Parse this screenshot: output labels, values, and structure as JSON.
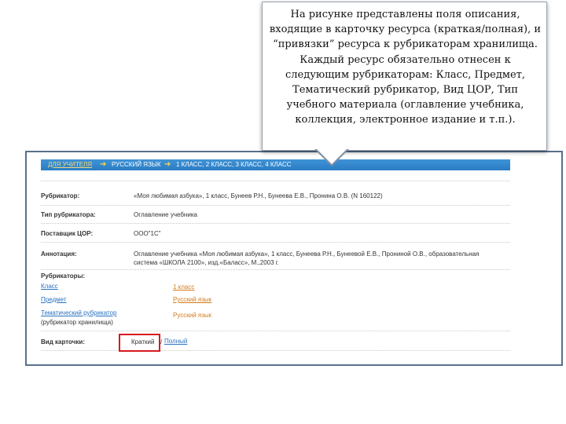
{
  "callout": {
    "text": "На рисунке представлены поля описания, входящие в карточку ресурса (краткая/полная), и “привязки” ресурса к рубрикаторам хранилища. Каждый ресурс обязательно отнесен к следующим рубрикаторам: Класс, Предмет, Тематический рубрикатор, Вид ЦОР, Тип учебного материала (оглавление учебника, коллекция, электронное издание и т.п.)."
  },
  "nav": {
    "items": [
      "Для учителя",
      "Русский язык",
      "1 класс, 2 класс, 3 класс, 4 класс"
    ],
    "arrow": "➔"
  },
  "card": {
    "rubricator_label": "Рубрикатор:",
    "rubricator_value": "«Моя любимая азбука», 1 класс, Бунеев Р.Н., Бунеева Е.В., Пронина О.В. (N 160122)",
    "type_label": "Тип рубрикатора:",
    "type_value": "Оглавление учебника",
    "cor_label": "Поставщик ЦОР:",
    "cor_value": "ООО\"1С\"",
    "annotation_label": "Аннотация:",
    "annotation_line1": "Оглавление учебника «Моя любимая азбука», 1 класс, Бунеева Р.Н., Бунеевой Е.В., Прониной О.В., образовательная",
    "annotation_line2": "система «ШКОЛА 2100», изд.«Баласс», М.,2003 г.",
    "rubricators_label": "Рубрикаторы:",
    "rubricators": [
      {
        "name": "Класс",
        "value": "1 класс"
      },
      {
        "name": "Предмет",
        "value": "Русский язык"
      },
      {
        "name_line1": "Тематический рубрикатор",
        "name_line2": "(рубрикатор хранилища)",
        "value": "Русский язык"
      }
    ],
    "view_label": "Вид карточки:",
    "view_short": "Краткий",
    "view_separator": "/",
    "view_full": "Полный"
  }
}
